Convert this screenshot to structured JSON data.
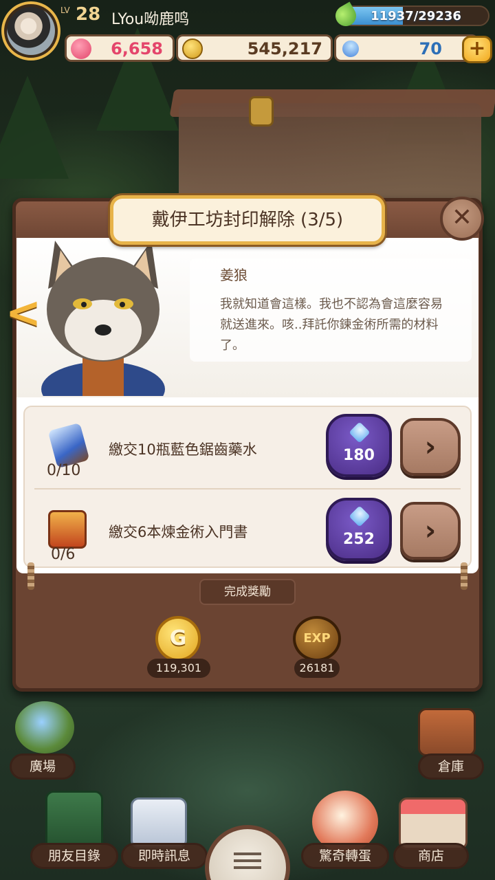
{
  "player": {
    "level_label": "LV",
    "level": "28",
    "name": "LYou呦鹿鸣"
  },
  "exp_bar": {
    "text": "11937/29236",
    "progress_fraction": 0.408
  },
  "resources": {
    "hearts": "6,658",
    "coins": "545,217",
    "gems": "70",
    "add_label": "+"
  },
  "dialog": {
    "title": "戴伊工坊封印解除 (3/5)",
    "close_label": "✕",
    "prev_label": "<",
    "speaker": "姜狼",
    "message": "我就知道會這樣。我也不認為會這麼容易就送進來。咳..拜託你鍊金術所需的材料了。"
  },
  "tasks": [
    {
      "progress": "0/10",
      "description": "繳交10瓶藍色鋸齒藥水",
      "gem_cost": "180",
      "go_label": "›"
    },
    {
      "progress": "0/6",
      "description": "繳交6本煉金術入門書",
      "gem_cost": "252",
      "go_label": "›"
    }
  ],
  "rewards": {
    "label": "完成獎勵",
    "coin_symbol": "G",
    "coin_value": "119,301",
    "exp_symbol": "EXP",
    "exp_value": "26181"
  },
  "bottom_nav": {
    "plaza": "廣場",
    "warehouse": "倉庫",
    "friends": "朋友目錄",
    "messages": "即時訊息",
    "gacha": "驚奇轉蛋",
    "shop": "商店"
  },
  "colors": {
    "accent_gold": "#e7b34a",
    "gem_purple": "#4b2d86",
    "panel_brown": "#6b4432"
  }
}
